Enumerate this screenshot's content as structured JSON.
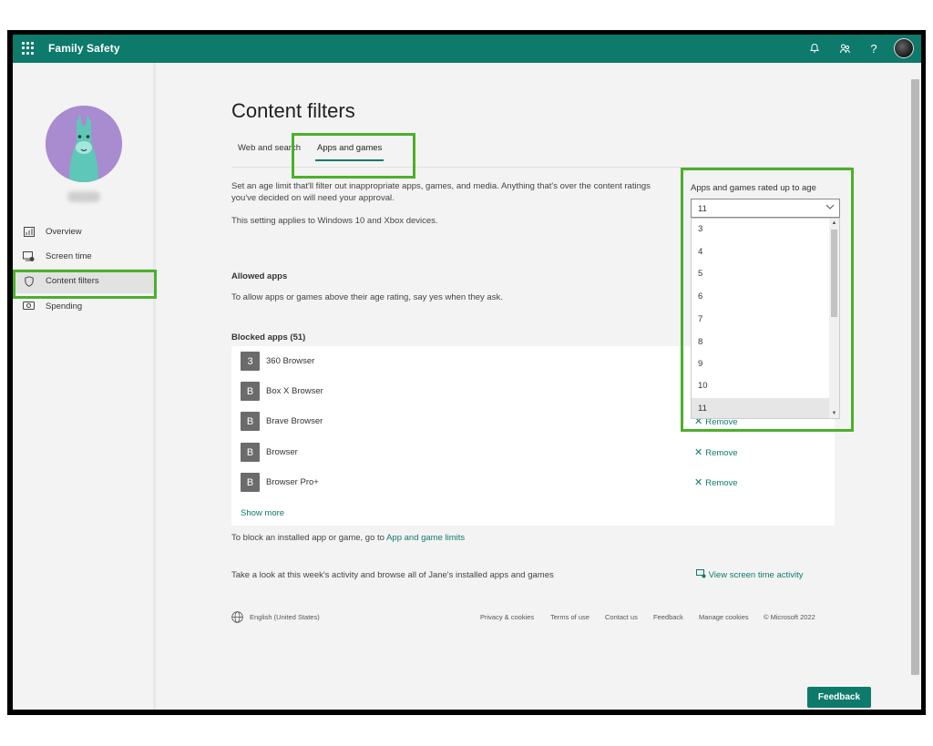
{
  "header": {
    "title": "Family Safety",
    "icons": [
      "app-launcher-icon",
      "bell-icon",
      "family-icon",
      "help-icon"
    ]
  },
  "sidebar": {
    "items": [
      {
        "label": "Overview",
        "icon": "overview-icon"
      },
      {
        "label": "Screen time",
        "icon": "screen-time-icon"
      },
      {
        "label": "Content filters",
        "icon": "shield-icon",
        "active": true
      },
      {
        "label": "Spending",
        "icon": "spending-icon"
      }
    ]
  },
  "main": {
    "title": "Content filters",
    "tabs": [
      {
        "label": "Web and search"
      },
      {
        "label": "Apps and games",
        "active": true
      }
    ],
    "description": "Set an age limit that'll filter out inappropriate apps, games, and media. Anything that's over the content ratings you've decided on will need your approval.",
    "applies_to": "This setting applies to Windows 10 and Xbox devices.",
    "allowed_apps_title": "Allowed apps",
    "allowed_apps_text": "To allow apps or games above their age rating, say yes when they ask.",
    "blocked_apps_title": "Blocked apps (51)",
    "blocked_apps": [
      {
        "initial": "3",
        "name": "360 Browser"
      },
      {
        "initial": "B",
        "name": "Box X Browser"
      },
      {
        "initial": "B",
        "name": "Brave Browser",
        "action": "Remove"
      },
      {
        "initial": "B",
        "name": "Browser",
        "action": "Remove"
      },
      {
        "initial": "B",
        "name": "Browser Pro+",
        "action": "Remove"
      }
    ],
    "show_more": "Show more",
    "block_hint_prefix": "To block an installed app or game, go to",
    "block_hint_link": "App and game limits",
    "activity_text": "Take a look at this week's activity and browse all of Jane's installed apps and games",
    "activity_link": "View screen time activity"
  },
  "age_filter": {
    "label": "Apps and games rated up to age",
    "selected": "11",
    "options": [
      "3",
      "4",
      "5",
      "6",
      "7",
      "8",
      "9",
      "10",
      "11"
    ]
  },
  "footer": {
    "language": "English (United States)",
    "links": [
      "Privacy & cookies",
      "Terms of use",
      "Contact us",
      "Feedback",
      "Manage cookies"
    ],
    "copyright": "© Microsoft 2022"
  },
  "feedback_button": "Feedback",
  "colors": {
    "brand": "#0e7a6b",
    "highlight": "#4caf2b"
  }
}
